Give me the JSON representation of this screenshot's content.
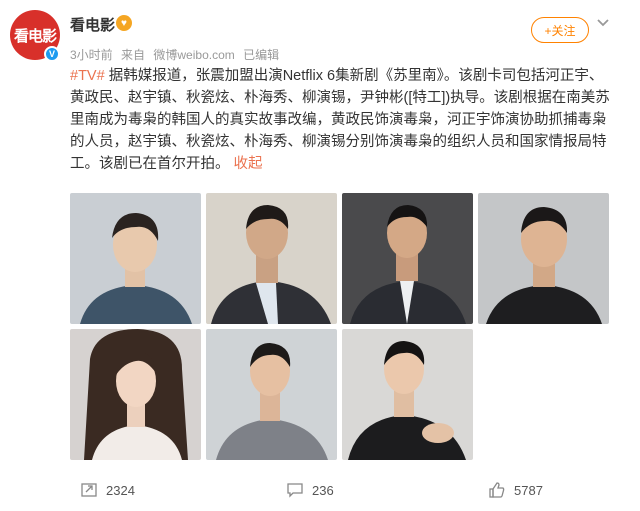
{
  "header": {
    "avatar_text": "看电影",
    "username": "看电影",
    "member_badge_icon": "member-heart-icon",
    "verified_icon": "v-verified-icon",
    "time": "3小时前",
    "source_prefix": "来自",
    "source": "微博weibo.com",
    "edited": "已编辑",
    "follow_label": "+关注",
    "more_icon": "chevron-down-icon"
  },
  "post": {
    "topic": "#TV#",
    "text": " 据韩媒报道，张震加盟出演Netflix 6集新剧《苏里南》。该剧卡司包括河正宇、黄政民、赵宇镇、秋瓷炫、朴海秀、柳演锡，尹钟彬([特工])执导。该剧根据在南美苏里南成为毒枭的韩国人的真实故事改编，黄政民饰演毒枭，河正宇饰演协助抓捕毒枭的人员，赵宇镇、秋瓷炫、朴海秀、柳演锡分别饰演毒枭的组织人员和国家情报局特工。该剧已在首尔开拍。",
    "collapse_label": "收起"
  },
  "photos": [
    {
      "name": "photo-actor-1",
      "bg": "#c9ced3",
      "shirt": "#3e5468"
    },
    {
      "name": "photo-actor-2",
      "bg": "#d8d3ca",
      "shirt": "#2f3036"
    },
    {
      "name": "photo-actor-3",
      "bg": "#4a4a4c",
      "shirt": "#2a2c32"
    },
    {
      "name": "photo-actor-4",
      "bg": "#c4c6c8",
      "shirt": "#1e1e20"
    },
    {
      "name": "photo-actress-5",
      "bg": "#d6d2d0",
      "shirt": "#f2ece8"
    },
    {
      "name": "photo-actor-6",
      "bg": "#cfd3d6",
      "shirt": "#7e8188"
    },
    {
      "name": "photo-actor-7",
      "bg": "#d9d8d6",
      "shirt": "#1c1c1e"
    }
  ],
  "actions": {
    "repost_icon": "repost-icon",
    "repost_count": "2324",
    "comment_icon": "comment-icon",
    "comment_count": "236",
    "like_icon": "thumbs-up-icon",
    "like_count": "5787"
  }
}
